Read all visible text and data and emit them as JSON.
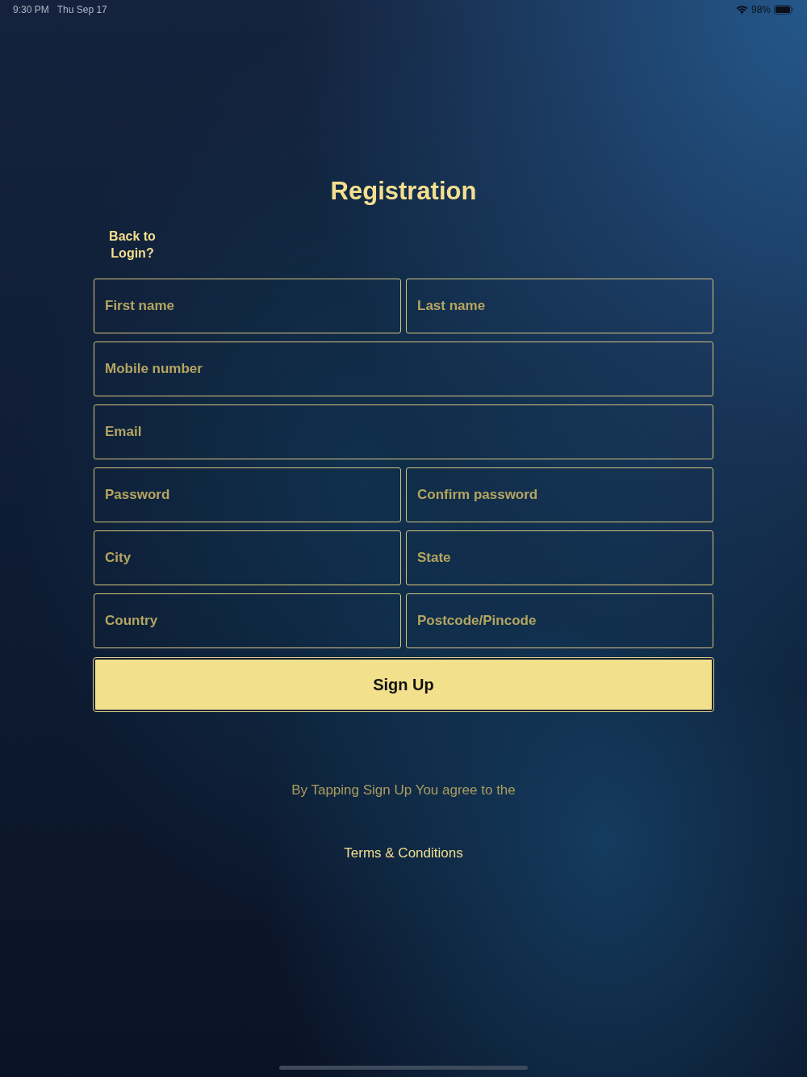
{
  "status_bar": {
    "time": "9:30 PM",
    "date": "Thu Sep 17",
    "battery": "98%"
  },
  "title": "Registration",
  "back_link": "Back to Login?",
  "form": {
    "rows": [
      {
        "fields": [
          {
            "placeholder": "First name"
          },
          {
            "placeholder": "Last name"
          }
        ]
      },
      {
        "fields": [
          {
            "placeholder": "Mobile number"
          }
        ]
      },
      {
        "fields": [
          {
            "placeholder": "Email"
          }
        ]
      },
      {
        "fields": [
          {
            "placeholder": "Password"
          },
          {
            "placeholder": "Confirm password"
          }
        ]
      },
      {
        "fields": [
          {
            "placeholder": "City"
          },
          {
            "placeholder": "State"
          }
        ]
      },
      {
        "fields": [
          {
            "placeholder": "Country"
          },
          {
            "placeholder": "Postcode/Pincode"
          }
        ]
      }
    ],
    "submit": "Sign Up"
  },
  "agreement_text": "By Tapping Sign Up You agree to the",
  "terms_link": "Terms & Conditions"
}
